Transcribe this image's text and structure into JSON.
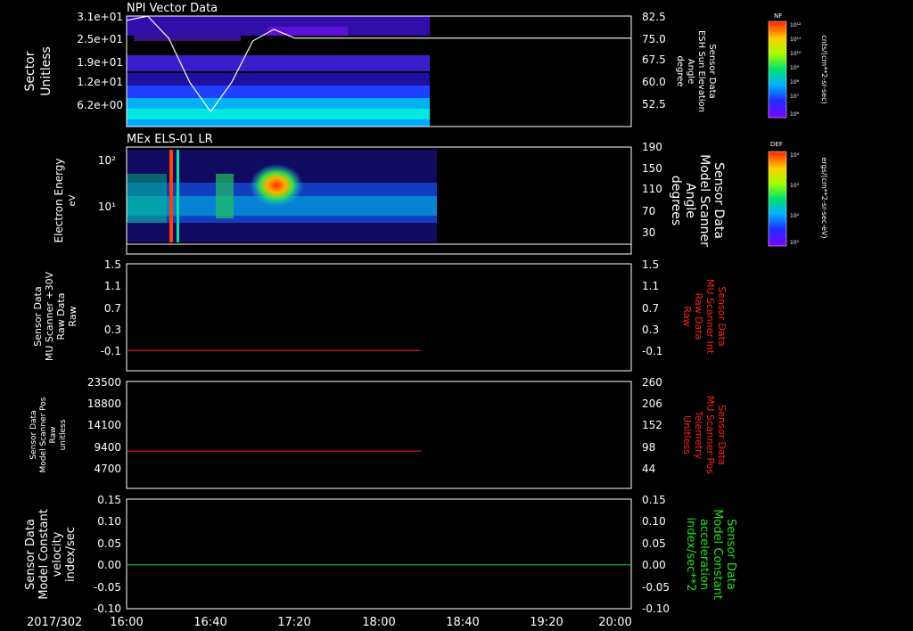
{
  "date_label": "2017/302",
  "time_ticks": [
    "16:00",
    "16:40",
    "17:20",
    "18:00",
    "18:40",
    "19:20",
    "20:00"
  ],
  "chart_data": [
    {
      "type": "heatmap",
      "title": "NPI Vector Data",
      "ylabel": [
        "Sector",
        "Unitless"
      ],
      "yticks": [
        "3.1e+01",
        "2.5e+01",
        "1.9e+01",
        "1.2e+01",
        "6.2e+00"
      ],
      "ylabel_right": [
        "Sensor Data",
        "ESH Sun Elevation",
        "Angle",
        "degree"
      ],
      "yticks_right": [
        "82.5",
        "75.0",
        "67.5",
        "60.0",
        "52.5"
      ],
      "data_end_time": "18:10",
      "overlay_line": {
        "name": "ESH Sun Elevation Angle",
        "x": [
          "16:00",
          "16:10",
          "16:20",
          "16:30",
          "16:40",
          "16:50",
          "17:00",
          "17:10",
          "17:20",
          "18:00",
          "18:40",
          "19:20",
          "20:00"
        ],
        "y": [
          81,
          82.5,
          75,
          60,
          50,
          60,
          74,
          78,
          75,
          75,
          75,
          75,
          75
        ]
      },
      "colorbar": {
        "label": "NF",
        "units": "cnts/(cm**2-sr-sec)",
        "ticks": [
          "10¹²",
          "10¹¹",
          "10¹⁰",
          "10⁹",
          "10⁸",
          "10⁷",
          "10⁶"
        ]
      }
    },
    {
      "type": "heatmap",
      "title": "MEx ELS-01 LR",
      "ylabel": [
        "Electron Energy",
        "eV"
      ],
      "yticks": [
        "10²",
        "10¹"
      ],
      "ylabel_right": [
        "Sensor Data",
        "Model Scanner",
        "Angle",
        "degrees"
      ],
      "yticks_right": [
        "190",
        "150",
        "110",
        "70",
        "30"
      ],
      "data_end_time": "18:15",
      "overlay_line": {
        "name": "Model Scanner Angle",
        "x": [
          "16:00",
          "20:00"
        ],
        "y": [
          13,
          13
        ]
      },
      "colorbar": {
        "label": "DEF",
        "units": "ergs/(cm**2-sr-sec-eV)",
        "ticks": [
          "10⁴",
          "10³",
          "10²",
          "10¹"
        ]
      }
    },
    {
      "type": "line",
      "ylabel": [
        "Sensor Data",
        "MU Scanner +30V",
        "Raw Data",
        "Raw"
      ],
      "yticks": [
        "1.5",
        "1.1",
        "0.7",
        "0.3",
        "-0.1"
      ],
      "ylim": [
        -0.35,
        1.5
      ],
      "ylabel_right": [
        "Sensor Data",
        "MU Scanner Int",
        "Raw Data",
        "Raw"
      ],
      "yticks_right": [
        "1.5",
        "1.1",
        "0.7",
        "0.3",
        "-0.1"
      ],
      "series": [
        {
          "x": [
            "16:00",
            "18:20"
          ],
          "y": [
            0.0,
            0.0
          ],
          "color": "#ff2020"
        }
      ]
    },
    {
      "type": "line",
      "ylabel": [
        "Sensor Data",
        "Model Scanner Pos",
        "Raw",
        "unitless"
      ],
      "yticks": [
        "23500",
        "18800",
        "14100",
        "9400",
        "4700"
      ],
      "ylim": [
        0,
        23500
      ],
      "ylabel_right": [
        "Sensor Data",
        "MU Scanner Pos",
        "Telemetry",
        "Unitless"
      ],
      "yticks_right": [
        "260",
        "206",
        "152",
        "98",
        "44"
      ],
      "series": [
        {
          "x": [
            "16:00",
            "18:20"
          ],
          "y": [
            8200,
            8200
          ],
          "color": "#ff2020"
        }
      ]
    },
    {
      "type": "line",
      "ylabel": [
        "Sensor Data",
        "Model Constant",
        "velocity",
        "index/sec"
      ],
      "yticks": [
        "0.15",
        "0.10",
        "0.05",
        "0.00",
        "-0.05",
        "-0.10"
      ],
      "ylim": [
        -0.1,
        0.15
      ],
      "ylabel_right": [
        "Sensor Data",
        "Model Constant",
        "acceleration",
        "index/sec**2"
      ],
      "yticks_right": [
        "0.15",
        "0.10",
        "0.05",
        "0.00",
        "-0.05",
        "-0.10"
      ],
      "series": [
        {
          "x": [
            "16:00",
            "20:00"
          ],
          "y": [
            0.0,
            0.0
          ],
          "color": "#20e020"
        }
      ]
    }
  ]
}
